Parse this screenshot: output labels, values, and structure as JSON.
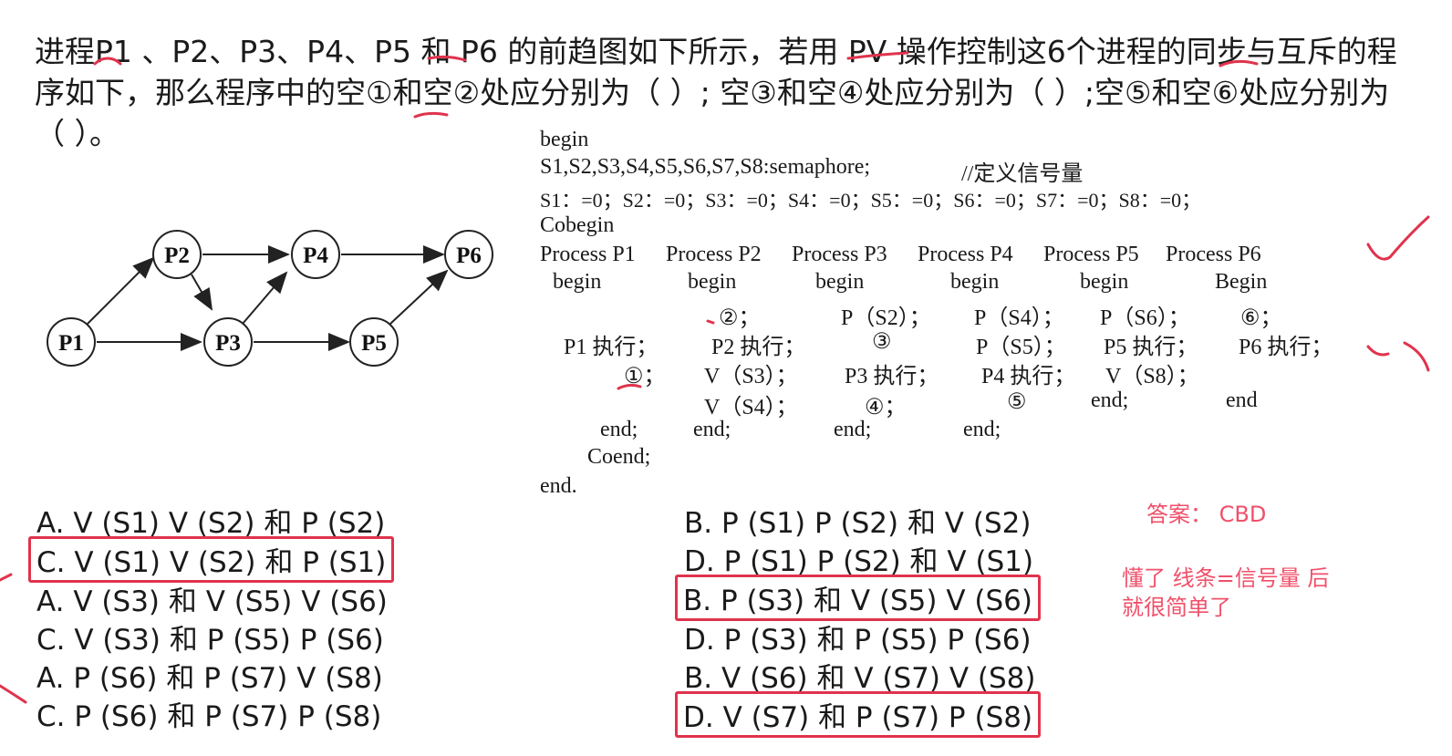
{
  "question": {
    "text": "进程P1 、P2、P3、P4、P5 和 P6 的前趋图如下所示，若用 PV 操作控制这6个进程的同步与互斥的程序如下，那么程序中的空①和空②处应分别为（ ）; 空③和空④处应分别为（ ）;空⑤和空⑥处应分别为（ ）。"
  },
  "diagram": {
    "nodes": [
      "P1",
      "P2",
      "P3",
      "P4",
      "P5",
      "P6"
    ]
  },
  "code": {
    "l_begin": "begin",
    "l_decl": "S1,S2,S3,S4,S5,S6,S7,S8:semaphore;",
    "l_comment": "//定义信号量",
    "l_init": "S1：=0；S2：=0；S3：=0；S4：=0；S5：=0；S6：=0；S7：=0；S8：=0；",
    "l_cobegin": "Cobegin",
    "proc_p1": "Process P1",
    "proc_p2": "Process P2",
    "proc_p3": "Process P3",
    "proc_p4": "Process P4",
    "proc_p5": "Process P5",
    "proc_p6": "Process P6",
    "b1": "begin",
    "b2": "begin",
    "b3": "begin",
    "b4": "begin",
    "b5": "begin",
    "b6": "Begin",
    "p2_blank2": "②；",
    "p3_ps2": "P（S2）；",
    "p4_ps4": "P（S4）；",
    "p5_ps6": "P（S6）；",
    "p6_blank6": "⑥；",
    "p1_exec": "P1 执行；",
    "p2_exec": "P2 执行；",
    "p3_blank3": "③",
    "p4_ps5": "P（S5）；",
    "p5_exec": "P5 执行；",
    "p6_exec": "P6 执行；",
    "p1_blank1": "①；",
    "p2_vs3": "V（S3）；",
    "p3_exec": "P3 执行；",
    "p4_exec": "P4 执行；",
    "p5_vs8": "V（S8）；",
    "p2_vs4": "V（S4）；",
    "p3_blank4": "④；",
    "p4_blank5": "⑤",
    "e5": "end;",
    "e6": "end",
    "e1": "end;",
    "e2": "end;",
    "e3": "end;",
    "e4": "end;",
    "l_coend": "Coend;",
    "l_end": "end."
  },
  "options": {
    "q1a": "A. V (S1) V (S2) 和 P (S2)",
    "q1b": "B. P (S1) P (S2) 和 V (S2)",
    "q1c": "C. V (S1) V (S2) 和 P (S1)",
    "q1d": "D. P (S1) P (S2) 和 V (S1)",
    "q2a": "A. V (S3) 和 V (S5) V (S6)",
    "q2b": "B. P (S3) 和 V (S5) V (S6)",
    "q2c": "C. V (S3) 和 P (S5) P (S6)",
    "q2d": "D. P (S3) 和 P (S5) P (S6)",
    "q3a": "A. P (S6) 和 P (S7) V (S8)",
    "q3b": "B. V (S6) 和 V (S7) V (S8)",
    "q3c": "C. P (S6) 和 P (S7) P (S8)",
    "q3d": "D. V (S7) 和 P (S7) P (S8)"
  },
  "answer": {
    "label": "答案：  CBD",
    "note_line1": "懂了 线条=信号量 后",
    "note_line2": "就很简单了"
  },
  "colors": {
    "highlight": "#e0334d",
    "answer_text": "#f0506a"
  }
}
